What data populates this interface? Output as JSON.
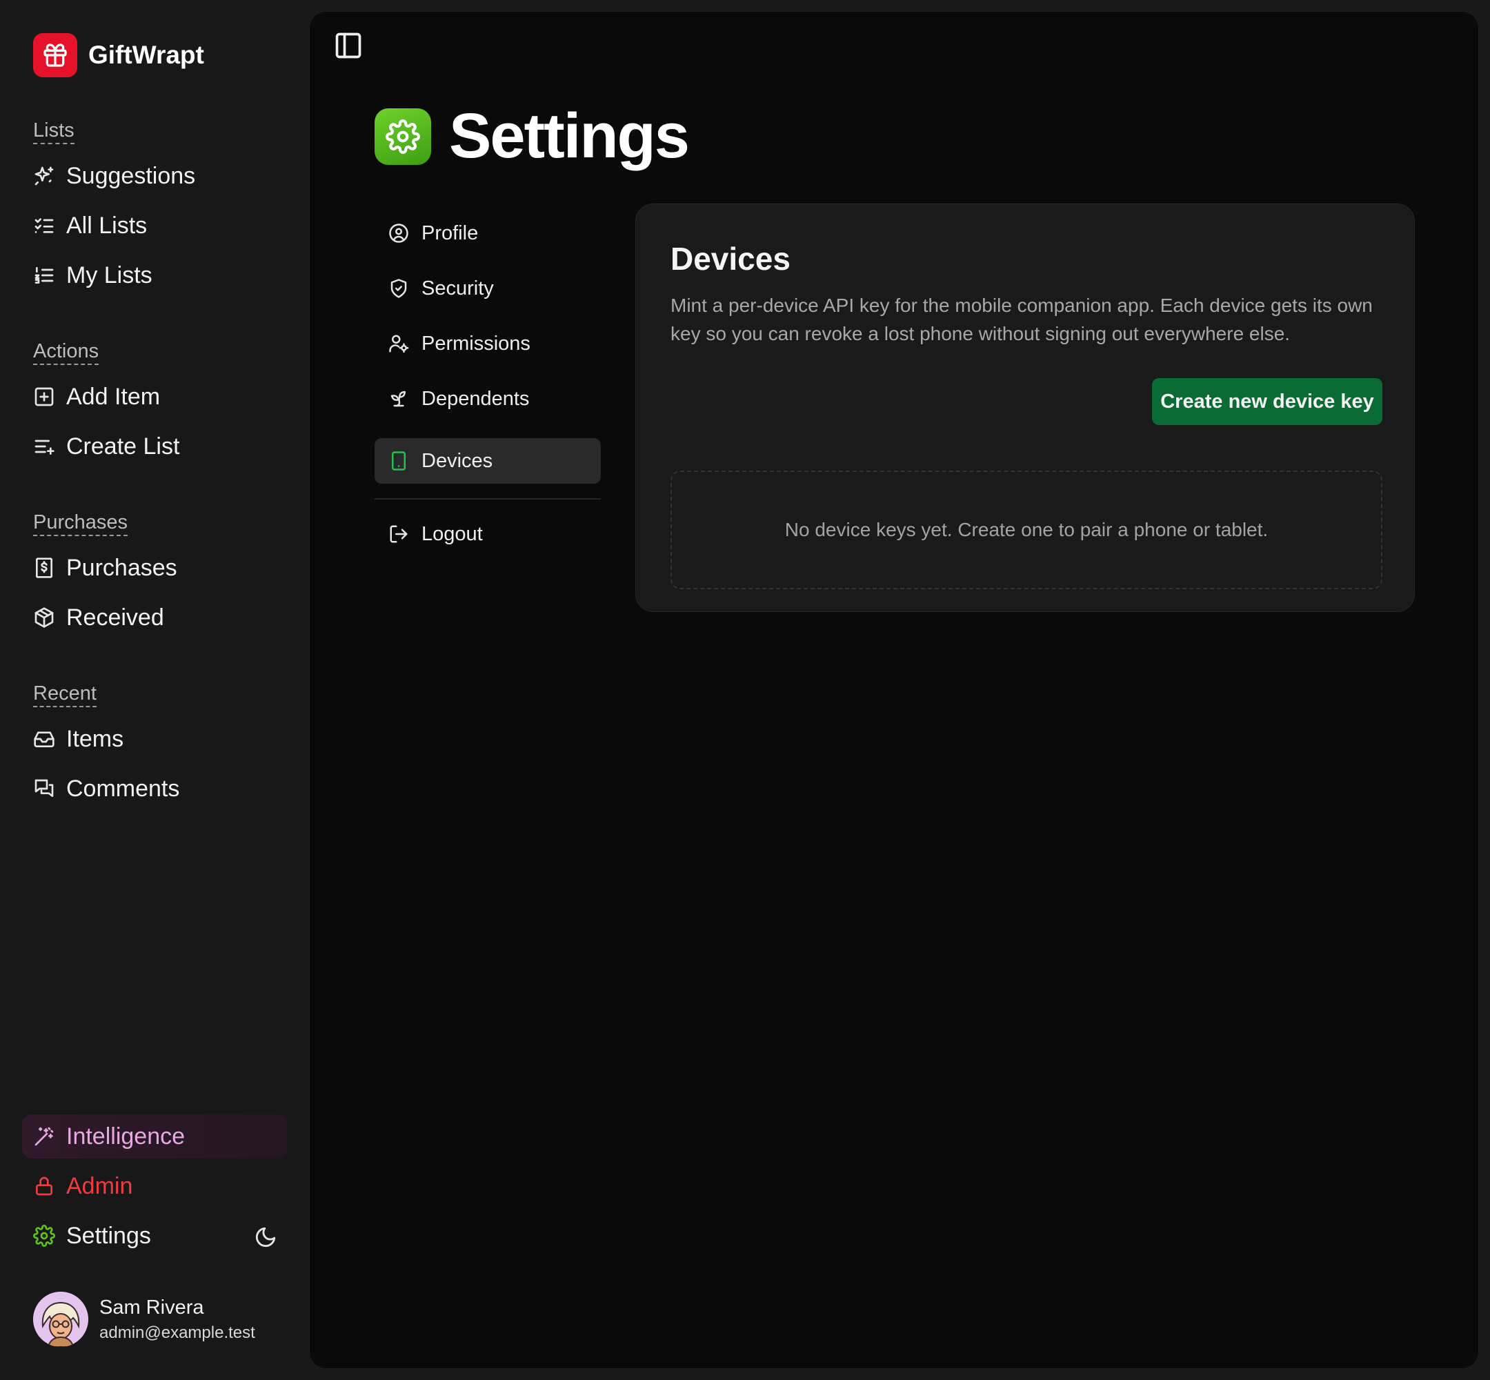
{
  "app": {
    "name": "GiftWrapt",
    "logo_icon": "gift-icon",
    "brand_color": "#e5122a"
  },
  "sidebar": {
    "sections": [
      {
        "label": "Lists",
        "items": [
          {
            "label": "Suggestions",
            "icon": "sparkles-icon"
          },
          {
            "label": "All Lists",
            "icon": "list-checks-icon"
          },
          {
            "label": "My Lists",
            "icon": "list-ordered-icon"
          }
        ]
      },
      {
        "label": "Actions",
        "items": [
          {
            "label": "Add Item",
            "icon": "square-plus-icon"
          },
          {
            "label": "Create List",
            "icon": "list-plus-icon"
          }
        ]
      },
      {
        "label": "Purchases",
        "items": [
          {
            "label": "Purchases",
            "icon": "receipt-icon"
          },
          {
            "label": "Received",
            "icon": "package-open-icon"
          }
        ]
      },
      {
        "label": "Recent",
        "items": [
          {
            "label": "Items",
            "icon": "inbox-icon"
          },
          {
            "label": "Comments",
            "icon": "messages-icon"
          }
        ]
      }
    ],
    "footer_items": [
      {
        "label": "Intelligence",
        "icon": "magic-wand-icon",
        "color": "#e9a8e4"
      },
      {
        "label": "Admin",
        "icon": "lock-icon",
        "color": "#ef3b42"
      },
      {
        "label": "Settings",
        "icon": "gear-icon",
        "color": "#5cc41f"
      }
    ],
    "theme_toggle_icon": "moon-icon",
    "user": {
      "name": "Sam Rivera",
      "email": "admin@example.test"
    }
  },
  "main": {
    "sidebar_toggle_icon": "panel-left-icon",
    "page_title": "Settings",
    "page_icon": "gear-icon",
    "page_icon_color": "#5cc41f",
    "settings_nav": [
      {
        "label": "Profile",
        "icon": "user-circle-icon",
        "active": false
      },
      {
        "label": "Security",
        "icon": "shield-check-icon",
        "active": false
      },
      {
        "label": "Permissions",
        "icon": "user-cog-icon",
        "active": false
      },
      {
        "label": "Dependents",
        "icon": "sprout-icon",
        "active": false
      },
      {
        "label": "Devices",
        "icon": "smartphone-icon",
        "active": true
      }
    ],
    "logout_label": "Logout",
    "card": {
      "title": "Devices",
      "description": "Mint a per-device API key for the mobile companion app. Each device gets its own key so you can revoke a lost phone without signing out everywhere else.",
      "create_button": "Create new device key",
      "create_button_color": "#0a6b34",
      "empty_state": "No device keys yet. Create one to pair a phone or tablet."
    }
  }
}
